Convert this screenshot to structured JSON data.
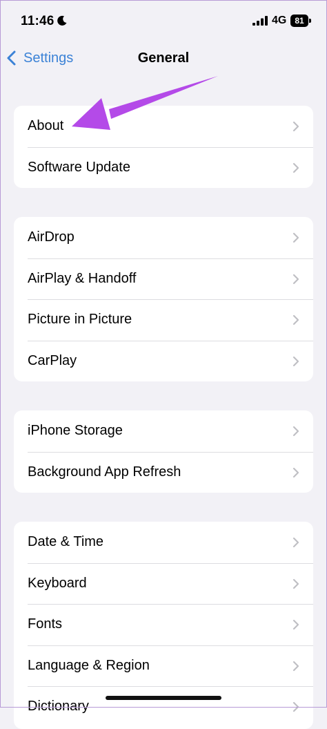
{
  "status_bar": {
    "time": "11:46",
    "network": "4G",
    "battery": "81"
  },
  "nav": {
    "back_label": "Settings",
    "title": "General"
  },
  "groups": [
    {
      "items": [
        {
          "label": "About"
        },
        {
          "label": "Software Update"
        }
      ]
    },
    {
      "items": [
        {
          "label": "AirDrop"
        },
        {
          "label": "AirPlay & Handoff"
        },
        {
          "label": "Picture in Picture"
        },
        {
          "label": "CarPlay"
        }
      ]
    },
    {
      "items": [
        {
          "label": "iPhone Storage"
        },
        {
          "label": "Background App Refresh"
        }
      ]
    },
    {
      "items": [
        {
          "label": "Date & Time"
        },
        {
          "label": "Keyboard"
        },
        {
          "label": "Fonts"
        },
        {
          "label": "Language & Region"
        },
        {
          "label": "Dictionary"
        }
      ]
    }
  ],
  "colors": {
    "accent": "#3b82d6",
    "background": "#f2f1f6",
    "annotation_arrow": "#b44ae8"
  }
}
